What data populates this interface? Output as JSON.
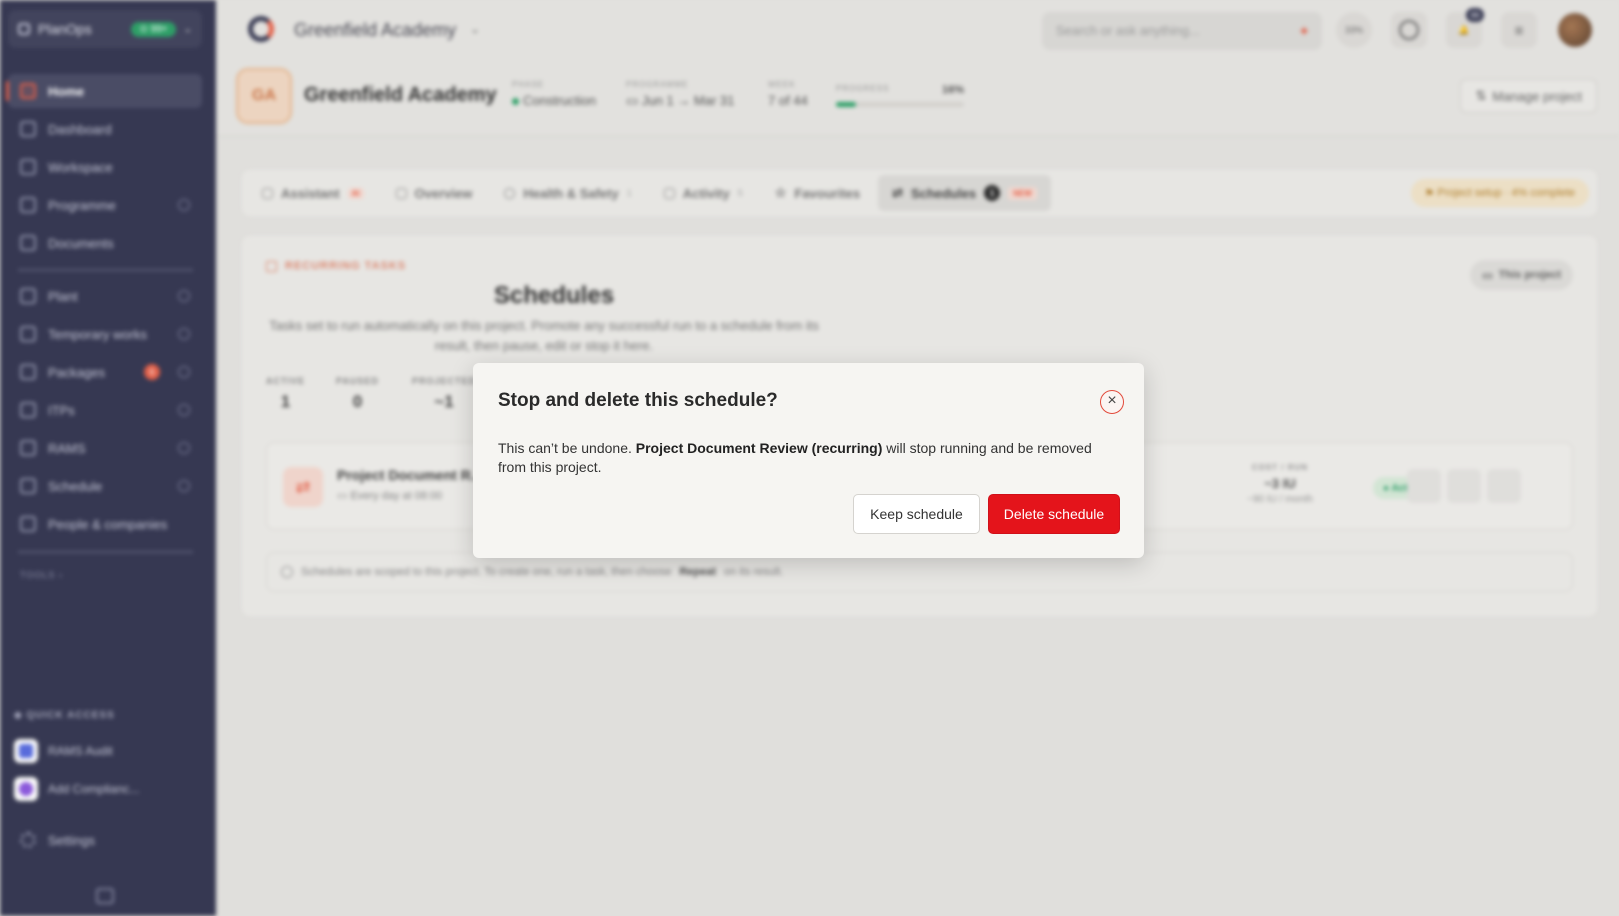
{
  "sidebar": {
    "org_name": "PlanOps",
    "org_badge": "⊙ 99+",
    "nav": [
      {
        "label": "Home"
      },
      {
        "label": "Dashboard"
      },
      {
        "label": "Workspace"
      },
      {
        "label": "Programme"
      },
      {
        "label": "Documents"
      },
      {
        "label": "Plant"
      },
      {
        "label": "Temporary works"
      },
      {
        "label": "Packages",
        "count": "6"
      },
      {
        "label": "ITPs"
      },
      {
        "label": "RAMS"
      },
      {
        "label": "Schedule"
      },
      {
        "label": "People & companies"
      }
    ],
    "tools_label": "TOOLS",
    "quick_access_label": "QUICK ACCESS",
    "quick_items": [
      {
        "label": "RAMS Audit"
      },
      {
        "label": "Add Complianc..."
      }
    ],
    "settings_label": "Settings"
  },
  "topbar": {
    "project_name": "Greenfield Academy",
    "search_placeholder": "Search or ask anything...",
    "usage": "33%",
    "notif_count": "99"
  },
  "project": {
    "initials": "GA",
    "name": "Greenfield Academy",
    "phase_label": "PHASE",
    "phase": "Construction",
    "programme_label": "PROGRAMME",
    "programme": "Jun 1 → Mar 31",
    "week_label": "WEEK",
    "week": "7 of 44",
    "progress_label": "PROGRESS",
    "progress_text": "16%",
    "progress": 0.16,
    "manage_label": "Manage project"
  },
  "tabs": [
    {
      "label": "Assistant",
      "tag": "AI"
    },
    {
      "label": "Overview"
    },
    {
      "label": "Health & Safety",
      "count": "1"
    },
    {
      "label": "Activity",
      "count": "5"
    },
    {
      "label": "Favourites"
    },
    {
      "label": "Schedules",
      "badge": "1",
      "tag": "NEW"
    }
  ],
  "setup_pill": "Project setup · 4% complete",
  "schedules": {
    "eyebrow": "RECURRING TASKS",
    "title": "Schedules",
    "description": "Tasks set to run automatically on this project. Promote any successful run to a schedule from its result, then pause, edit or stop it here.",
    "scope_pill": "This project",
    "stats": [
      {
        "label": "ACTIVE",
        "value": "1"
      },
      {
        "label": "PAUSED",
        "value": "0"
      },
      {
        "label": "PROJECTED",
        "value": "~1"
      }
    ],
    "row": {
      "title": "Project Document R...",
      "subtitle": "Every day at 08:00",
      "cost_label": "COST / RUN",
      "cost": "~3 IU",
      "cost_month": "~90 IU / month",
      "status": "● Active"
    },
    "note_prefix": "Schedules are scoped to this project. To create one, run a task, then choose ",
    "note_bold": "Repeat",
    "note_suffix": " on its result."
  },
  "dialog": {
    "title": "Stop and delete this schedule?",
    "body_prefix": "This can’t be undone. ",
    "body_bold": "Project Document Review (recurring)",
    "body_suffix": " will stop running and be removed from this project.",
    "close_glyph": "×",
    "keep_label": "Keep schedule",
    "delete_label": "Delete schedule"
  }
}
